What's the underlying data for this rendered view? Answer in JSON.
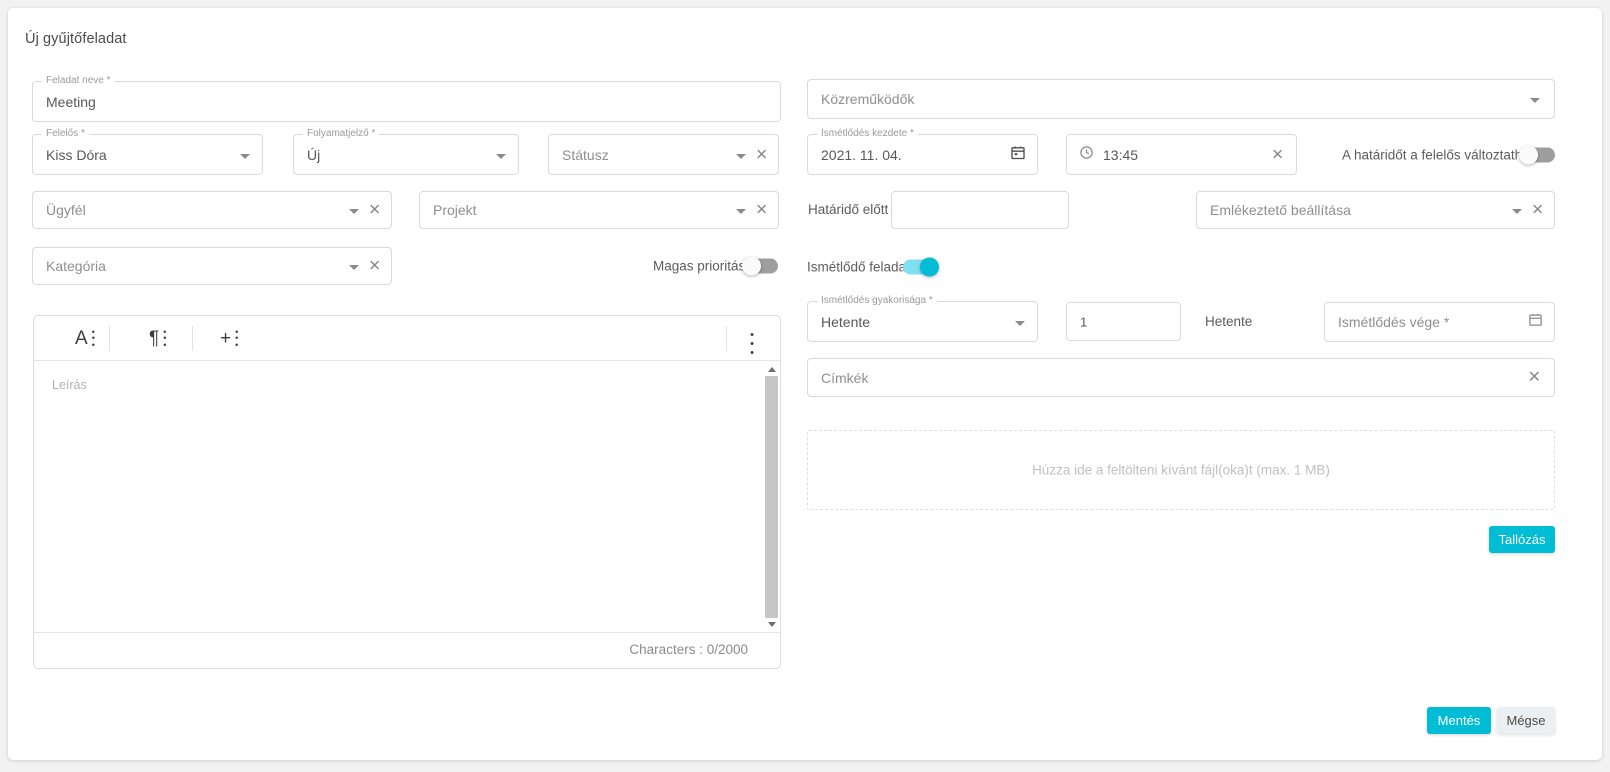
{
  "dialog": {
    "title": "Új gyűjtőfeladat"
  },
  "fields": {
    "task_name": {
      "legend": "Feladat neve",
      "required": true,
      "value": "Meeting"
    },
    "responsible": {
      "legend": "Felelős",
      "required": true,
      "value": "Kiss Dóra"
    },
    "process_state": {
      "legend": "Folyamatjelző",
      "required": true,
      "value": "Új"
    },
    "status": {
      "legend": "",
      "required": false,
      "placeholder": "Státusz"
    },
    "client": {
      "legend": "",
      "required": false,
      "placeholder": "Ügyfél"
    },
    "project": {
      "legend": "",
      "required": false,
      "placeholder": "Projekt"
    },
    "category": {
      "legend": "",
      "required": false,
      "placeholder": "Kategória"
    },
    "collaborators": {
      "legend": "",
      "required": false,
      "placeholder": "Közreműködők"
    },
    "repeat_start": {
      "legend": "Ismétlődés kezdete",
      "required": true,
      "value": "2021. 11. 04."
    },
    "time": {
      "legend": "",
      "required": false,
      "value": "13:45"
    },
    "before_deadline_label": "Határidő előtt",
    "before_deadline": {
      "legend": "",
      "required": false,
      "value": ""
    },
    "reminder": {
      "legend": "",
      "required": false,
      "placeholder": "Emlékeztető beállítása"
    },
    "repeat_freq": {
      "legend": "Ismétlődés gyakorisága",
      "required": true,
      "value": "Hetente"
    },
    "repeat_interval": {
      "legend": "",
      "required": false,
      "value": "1"
    },
    "repeat_unit_label": "Hetente",
    "repeat_end": {
      "legend": "",
      "required": false,
      "placeholder": "Ismétlődés vége *"
    },
    "tags": {
      "legend": "",
      "required": false,
      "placeholder": "Címkék"
    }
  },
  "toggles": {
    "deadline_changeable": {
      "label": "A határidőt a felelős változtathatja",
      "on": false
    },
    "high_priority": {
      "label": "Magas prioritású",
      "on": false
    },
    "recurring_task": {
      "label": "Ismétlődő feladat",
      "on": true
    }
  },
  "editor": {
    "placeholder": "Leírás",
    "char_count": "Characters : 0/2000",
    "toolbar": {
      "text_style": "A",
      "paragraph": "¶",
      "insert": "+"
    }
  },
  "upload": {
    "dropzone_text": "Húzza ide a feltölteni kívánt fájl(oka)t (max. 1 MB)",
    "browse_label": "Tallózás"
  },
  "actions": {
    "save_label": "Mentés",
    "cancel_label": "Mégse"
  },
  "colors": {
    "accent": "#00bcd4",
    "toggle_on_track": "#7fe0ef",
    "toggle_off_track": "#9e9e9e",
    "border": "#dadada",
    "text": "#585858",
    "placeholder": "#8f8f8f"
  }
}
